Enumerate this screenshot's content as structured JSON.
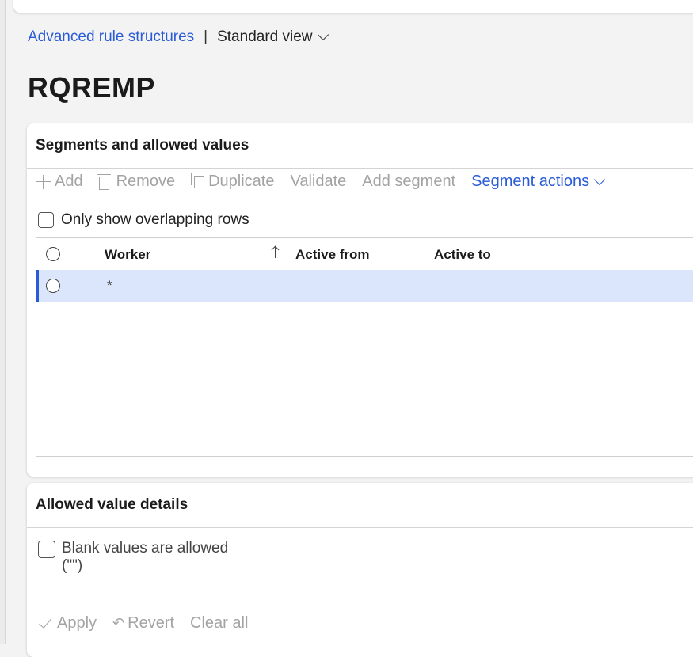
{
  "breadcrumb": {
    "link": "Advanced rule structures",
    "separator": "|",
    "view": "Standard view"
  },
  "page": {
    "title": "RQREMP"
  },
  "segments_card": {
    "title": "Segments and allowed values",
    "toolbar": {
      "add": "Add",
      "remove": "Remove",
      "duplicate": "Duplicate",
      "validate": "Validate",
      "add_segment": "Add segment",
      "segment_actions": "Segment actions"
    },
    "only_overlapping_label": "Only show overlapping rows",
    "grid": {
      "columns": {
        "worker": "Worker",
        "active_from": "Active from",
        "active_to": "Active to"
      },
      "rows": [
        {
          "worker": "*",
          "active_from": "",
          "active_to": ""
        }
      ]
    }
  },
  "details_card": {
    "title": "Allowed value details",
    "blank_values_label": "Blank values are allowed",
    "blank_values_hint": "(\"\")",
    "actions": {
      "apply": "Apply",
      "revert": "Revert",
      "clear_all": "Clear all"
    }
  },
  "colors": {
    "link": "#2a5bd7",
    "selected_row": "#dbe5fb",
    "disabled_text": "#a3a3a3"
  }
}
